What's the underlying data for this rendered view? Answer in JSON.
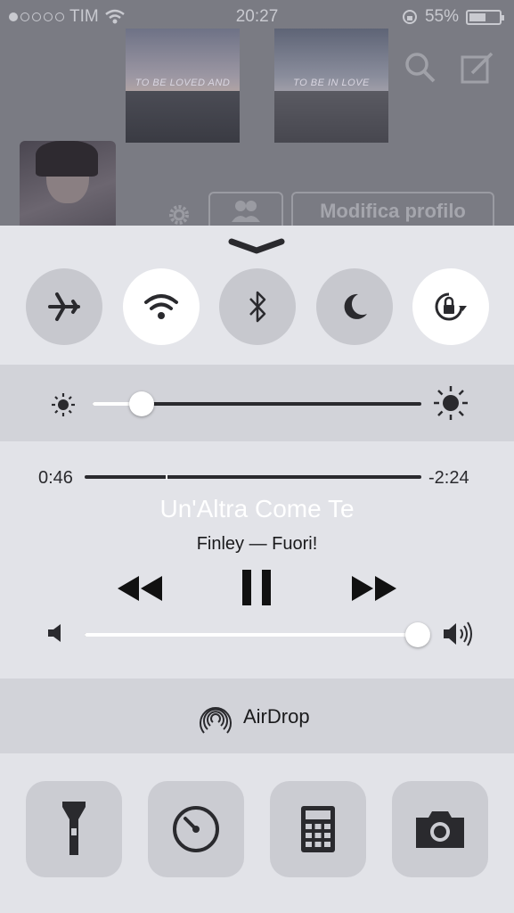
{
  "status_bar": {
    "carrier": "TIM",
    "signal_bars": 1,
    "time": "20:27",
    "battery_percent": "55%",
    "battery_level": 0.55
  },
  "profile": {
    "thumbnails": [
      {
        "caption": "TO BE LOVED AND"
      },
      {
        "caption": "TO BE IN LOVE"
      }
    ],
    "edit_button": "Modifica profilo"
  },
  "control_center": {
    "toggles": [
      {
        "name": "airplane-mode",
        "icon": "airplane-icon",
        "on": false
      },
      {
        "name": "wifi",
        "icon": "wifi-icon",
        "on": true
      },
      {
        "name": "bluetooth",
        "icon": "bluetooth-icon",
        "on": false
      },
      {
        "name": "do-not-disturb",
        "icon": "moon-icon",
        "on": false
      },
      {
        "name": "rotation-lock",
        "icon": "rotation-lock-icon",
        "on": true
      }
    ],
    "brightness": 0.12,
    "media": {
      "elapsed": "0:46",
      "remaining": "-2:24",
      "progress": 0.24,
      "title": "Un'Altra Come Te",
      "subtitle": "Finley — Fuori!",
      "volume": 1.0
    },
    "airdrop_label": "AirDrop",
    "apps": [
      {
        "name": "flashlight",
        "icon": "flashlight-icon"
      },
      {
        "name": "timer",
        "icon": "timer-icon"
      },
      {
        "name": "calculator",
        "icon": "calculator-icon"
      },
      {
        "name": "camera",
        "icon": "camera-icon"
      }
    ]
  },
  "colors": {
    "panel": "#e4e5ea",
    "toggle_off": "#c7c8ce",
    "toggle_on": "#ffffff",
    "icon_dark": "#2a2a2e",
    "title_gray": "#ffffff"
  }
}
